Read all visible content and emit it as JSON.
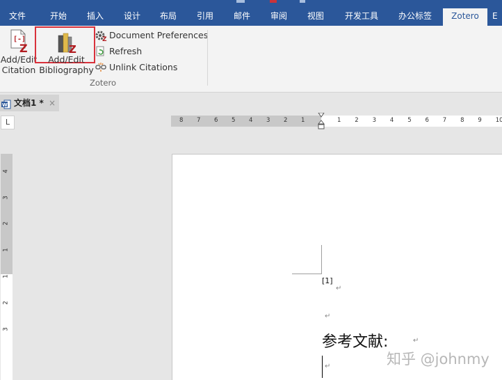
{
  "ribbon_tabs": [
    "文件",
    "开始",
    "插入",
    "设计",
    "布局",
    "引用",
    "邮件",
    "审阅",
    "视图",
    "开发工具",
    "办公标签",
    "Zotero",
    "E"
  ],
  "zotero_group": {
    "add_edit_citation": [
      "Add/Edit",
      "Citation"
    ],
    "add_edit_bibliography": [
      "Add/Edit",
      "Bibliography"
    ],
    "document_preferences": "Document Preferences",
    "refresh": "Refresh",
    "unlink_citations": "Unlink Citations",
    "group_label": "Zotero"
  },
  "document_tab": {
    "title": "文档1 *",
    "close": "×"
  },
  "ruler": {
    "corner": "L",
    "left_numbers": [
      "8",
      "7",
      "6",
      "5",
      "4",
      "3",
      "2",
      "1"
    ],
    "right_numbers": [
      "1",
      "2",
      "3",
      "4",
      "5",
      "6",
      "7",
      "8",
      "9",
      "10"
    ],
    "vertical_numbers": [
      "4",
      "3",
      "2",
      "1",
      "1",
      "2",
      "3"
    ]
  },
  "document": {
    "citation": "[1]",
    "heading": "参考文献:",
    "para_mark": "↵"
  },
  "watermark": "知乎 @johnmy",
  "colors": {
    "ribbon_blue": "#2b579a",
    "highlight_box": "#d9313b",
    "zotero_red": "#b11c20"
  }
}
